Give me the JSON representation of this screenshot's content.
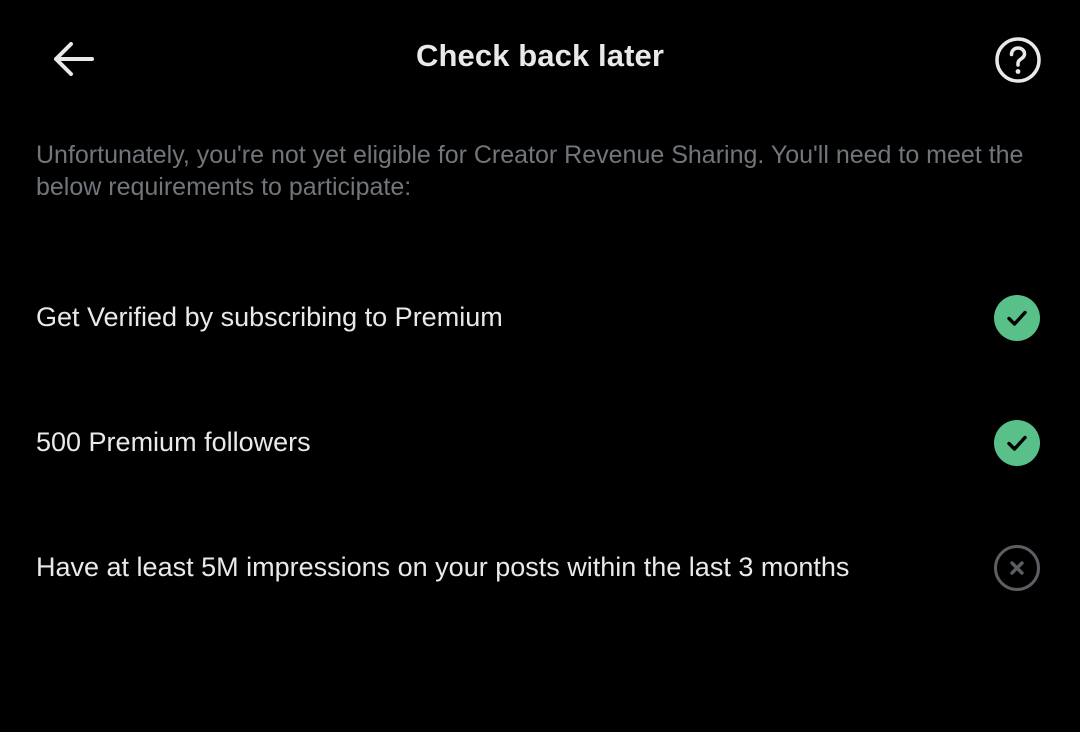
{
  "header": {
    "title": "Check back later",
    "back_icon": "arrow-left-icon",
    "help_icon": "question-circle-icon"
  },
  "intro": "Unfortunately, you're not yet eligible for Creator Revenue Sharing. You'll need to meet the below requirements to participate:",
  "requirements": [
    {
      "label": "Get Verified by subscribing to Premium",
      "status": "met",
      "icon": "check-circle-icon"
    },
    {
      "label": "500 Premium followers",
      "status": "met",
      "icon": "check-circle-icon"
    },
    {
      "label": "Have at least 5M impressions on your posts within the last 3 months",
      "status": "unmet",
      "icon": "x-circle-icon"
    }
  ],
  "colors": {
    "background": "#000000",
    "text_primary": "#e7e9ea",
    "text_secondary": "#71767b",
    "status_met": "#5ac08a",
    "status_unmet": "#5b5f63"
  }
}
